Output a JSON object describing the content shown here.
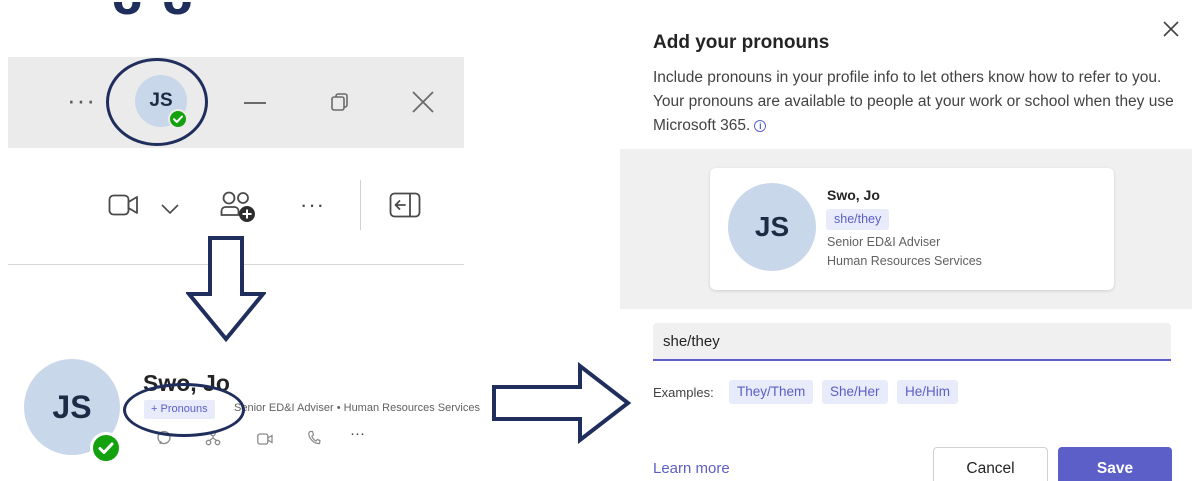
{
  "left_panel": {
    "titlebar": {
      "more_label": "···",
      "avatar_initials": "JS",
      "icons": [
        "more-icon",
        "minimize-icon",
        "restore-icon",
        "close-icon"
      ]
    },
    "toolbar": {
      "icons": [
        "video-camera-icon",
        "chevron-down-icon",
        "add-people-icon",
        "more-icon",
        "share-tray-icon"
      ],
      "more_label": "···"
    },
    "profile_card": {
      "avatar_initials": "JS",
      "name": "Swo, Jo",
      "pronouns_button": "+ Pronouns",
      "role_line": "Senior ED&I Adviser • Human Resources Services",
      "action_icons": [
        "chat-icon",
        "org-chart-icon",
        "video-icon",
        "call-icon",
        "more-icon"
      ],
      "more_label": "···"
    }
  },
  "dialog": {
    "title": "Add your pronouns",
    "description": "Include pronouns in your profile info to let others know how to refer to you. Your pronouns are available to people at your work or school when they use Microsoft 365.",
    "info_glyph": "i",
    "preview": {
      "avatar_initials": "JS",
      "name": "Swo, Jo",
      "pronouns": "she/they",
      "role": "Senior ED&I Adviser",
      "department": "Human Resources Services"
    },
    "input_value": "she/they",
    "examples_label": "Examples:",
    "examples": [
      "They/Them",
      "She/Her",
      "He/Him"
    ],
    "learn_more": "Learn more",
    "cancel_label": "Cancel",
    "save_label": "Save"
  },
  "colors": {
    "accent": "#5b5fc7",
    "annotation": "#1f2e5c",
    "presence": "#13a10e",
    "avatar_bg": "#c9d7ea"
  }
}
